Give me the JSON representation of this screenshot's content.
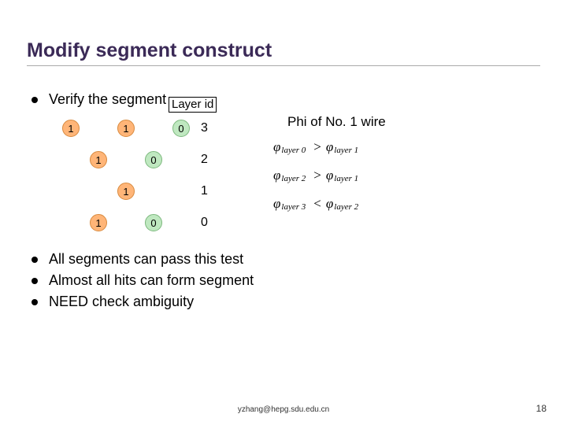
{
  "title": "Modify segment construct",
  "verify_label": "Verify the segment",
  "diagram": {
    "layer_id_header": "Layer id",
    "phi_title": "Phi of No. 1 wire",
    "rows": [
      {
        "cells": [
          {
            "t": "1",
            "k": "c1"
          },
          null,
          {
            "t": "1",
            "k": "c1"
          },
          null,
          {
            "t": "0",
            "k": "c0"
          }
        ],
        "layer_id": "3"
      },
      {
        "cells": [
          null,
          {
            "t": "1",
            "k": "c1"
          },
          null,
          {
            "t": "0",
            "k": "c0"
          },
          null
        ],
        "layer_id": "2"
      },
      {
        "cells": [
          null,
          null,
          {
            "t": "1",
            "k": "c1"
          },
          null,
          null
        ],
        "layer_id": "1"
      },
      {
        "cells": [
          null,
          {
            "t": "1",
            "k": "c1"
          },
          null,
          {
            "t": "0",
            "k": "c0"
          },
          null
        ],
        "layer_id": "0"
      }
    ],
    "inequalities": [
      {
        "left_var": "φ",
        "left_sub": "layer 0",
        "op": ">",
        "right_var": "φ",
        "right_sub": "layer 1"
      },
      {
        "left_var": "φ",
        "left_sub": "layer 2",
        "op": ">",
        "right_var": "φ",
        "right_sub": "layer 1"
      },
      {
        "left_var": "φ",
        "left_sub": "layer 3",
        "op": "<",
        "right_var": "φ",
        "right_sub": "layer 2"
      }
    ]
  },
  "conclusions": [
    "All segments can pass this test",
    "Almost all hits can form segment",
    "NEED check ambiguity"
  ],
  "footer": "yzhang@hepg.sdu.edu.cn",
  "page_number": "18"
}
